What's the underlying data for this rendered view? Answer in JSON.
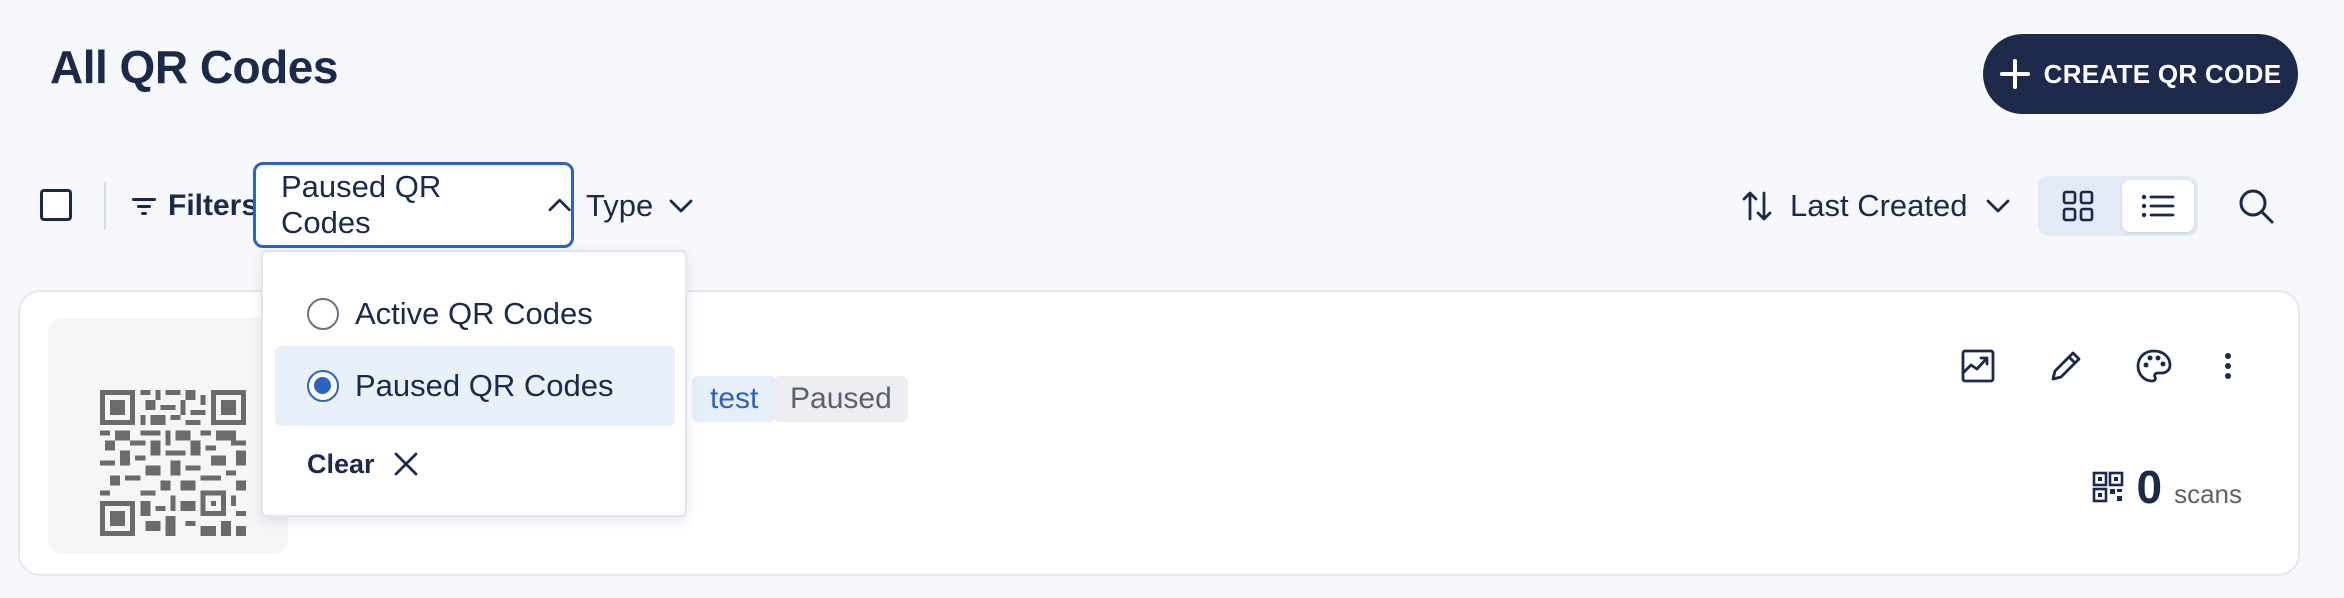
{
  "page": {
    "title": "All QR Codes"
  },
  "header": {
    "create_label": "CREATE QR CODE"
  },
  "toolbar": {
    "filters_label": "Filters",
    "status_filter_value": "Paused QR Codes",
    "type_label": "Type",
    "sort_label": "Last Created"
  },
  "status_dropdown": {
    "options": [
      {
        "label": "Active QR Codes",
        "selected": false
      },
      {
        "label": "Paused QR Codes",
        "selected": true
      }
    ],
    "clear_label": "Clear"
  },
  "card": {
    "folder_tag": "test",
    "status_tag": "Paused",
    "scans_count": "0",
    "scans_label": "scans"
  },
  "icons": {
    "create": "plus-icon",
    "filters": "filter-icon",
    "sort": "sort-icon",
    "grid": "grid-view-icon",
    "list": "list-view-icon",
    "search": "search-icon",
    "stats": "stats-icon",
    "edit": "pencil-icon",
    "design": "palette-icon",
    "more": "more-vertical-icon",
    "download": "download-icon",
    "qr": "qr-icon"
  },
  "colors": {
    "primary_dark": "#1d2a4c",
    "accent_blue": "#2a64c3",
    "selected_bg": "#e8f0fa"
  }
}
